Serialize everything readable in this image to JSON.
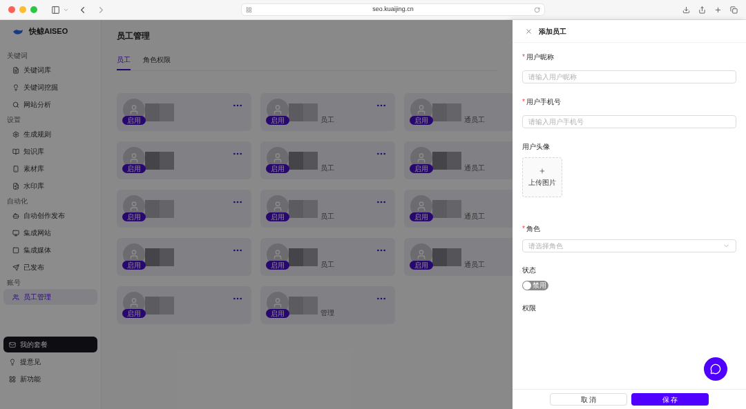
{
  "browser": {
    "url": "seo.kuaijing.cn"
  },
  "sidebar": {
    "logo": "快鲸AISEO",
    "sections": [
      {
        "title": "关键词",
        "items": [
          {
            "label": "关键词库",
            "selected": false
          },
          {
            "label": "关键词挖掘",
            "selected": false
          },
          {
            "label": "网站分析",
            "selected": false
          }
        ]
      },
      {
        "title": "设置",
        "items": [
          {
            "label": "生成规则",
            "selected": false
          },
          {
            "label": "知识库",
            "selected": false
          },
          {
            "label": "素材库",
            "selected": false
          },
          {
            "label": "水印库",
            "selected": false
          }
        ]
      },
      {
        "title": "自动化",
        "items": [
          {
            "label": "自动创作发布",
            "selected": false
          },
          {
            "label": "集成网站",
            "selected": false
          },
          {
            "label": "集成媒体",
            "selected": false
          },
          {
            "label": "已发布",
            "selected": false
          }
        ]
      },
      {
        "title": "账号",
        "items": [
          {
            "label": "员工管理",
            "selected": true
          }
        ]
      }
    ],
    "bottom": [
      {
        "label": "我的套餐",
        "selected": true
      },
      {
        "label": "提意见",
        "selected": false
      },
      {
        "label": "新功能",
        "selected": false
      }
    ]
  },
  "page": {
    "title": "员工管理",
    "tabs": [
      {
        "label": "员工",
        "selected": true
      },
      {
        "label": "角色权限",
        "selected": false
      }
    ],
    "cards": [
      {
        "status": "启用"
      },
      {
        "status": "启用",
        "role": "员工"
      },
      {
        "status": "启用",
        "role": "通员工"
      },
      {
        "status": "启用"
      },
      {
        "status": "启用",
        "role": "员工"
      },
      {
        "status": "启用",
        "role": "通员工"
      },
      {
        "status": "启用"
      },
      {
        "status": "启用",
        "role": "员工"
      },
      {
        "status": "启用",
        "role": "通员工"
      },
      {
        "status": "启用"
      },
      {
        "status": "启用",
        "role": "员工"
      },
      {
        "status": "启用",
        "role": "通员工"
      },
      {
        "status": "启用"
      },
      {
        "status": "启用",
        "role": "管理"
      }
    ]
  },
  "drawer": {
    "title": "添加员工",
    "fields": [
      {
        "kind": "text",
        "label": "用户昵称",
        "mark": "*",
        "placeholder": "请输入用户昵称"
      },
      {
        "kind": "text",
        "label": "用户手机号",
        "mark": "*",
        "placeholder": "请输入用户手机号"
      },
      {
        "kind": "upload",
        "label": "用户头像",
        "button": "上传图片"
      },
      {
        "kind": "select",
        "label": "角色",
        "mark": "*",
        "placeholder": "请选择角色"
      },
      {
        "kind": "switch",
        "label": "状态",
        "on": false,
        "text": "禁用"
      },
      {
        "kind": "section",
        "label": "权限"
      }
    ],
    "buttons": [
      {
        "label": "取 消",
        "kind": "secondary"
      },
      {
        "label": "保 存",
        "kind": "primary"
      }
    ]
  }
}
